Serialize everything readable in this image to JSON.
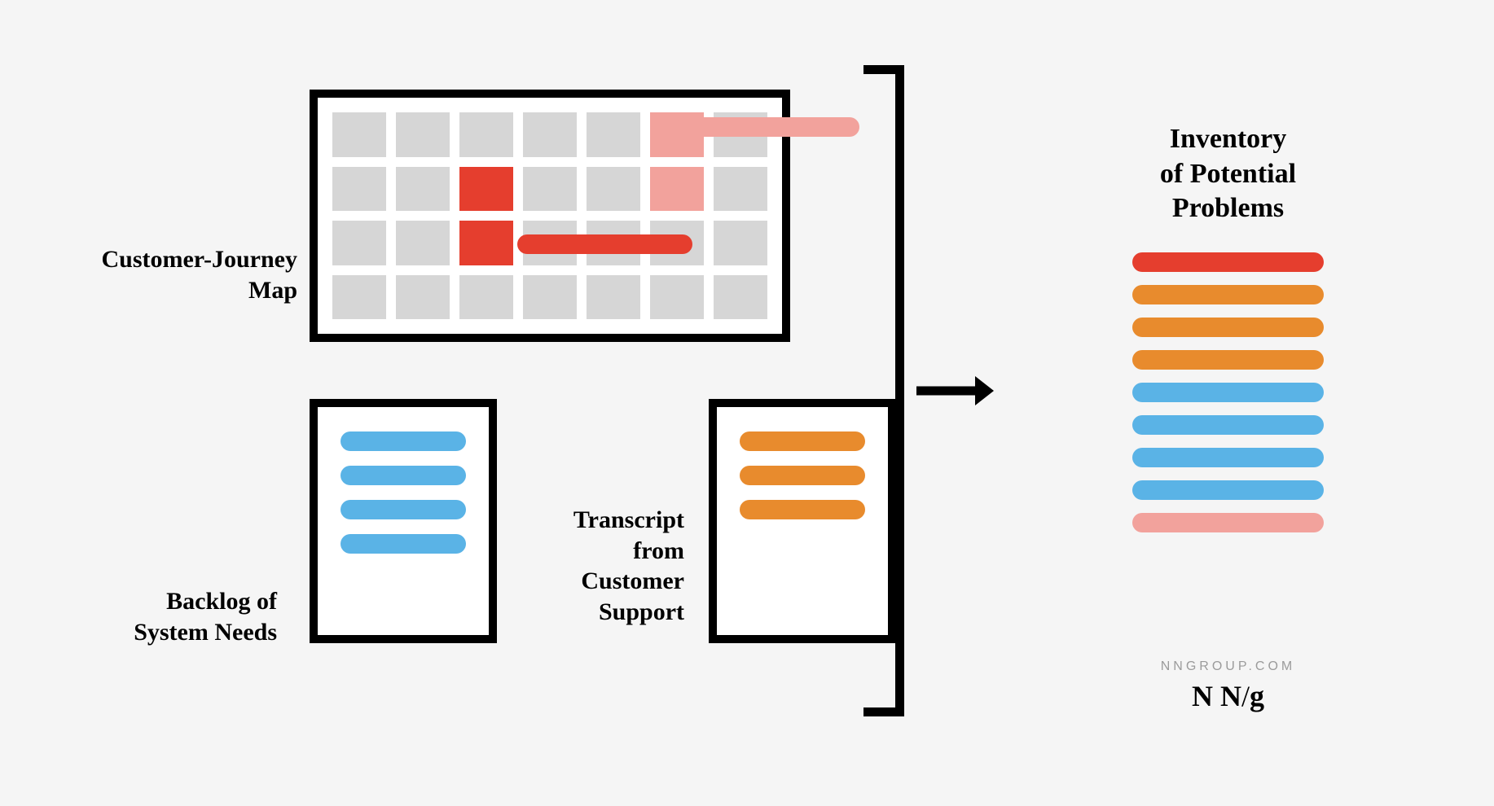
{
  "labels": {
    "journey_l1": "Customer-Journey",
    "journey_l2": "Map",
    "backlog_l1": "Backlog of",
    "backlog_l2": "System Needs",
    "transcript_l1": "Transcript",
    "transcript_l2": "from",
    "transcript_l3": "Customer",
    "transcript_l4": "Support",
    "inventory_l1": "Inventory",
    "inventory_l2": "of Potential",
    "inventory_l3": "Problems"
  },
  "journey_map": {
    "rows": 4,
    "cols": 7,
    "highlights": [
      {
        "row": 0,
        "col": 5,
        "style": "pink"
      },
      {
        "row": 1,
        "col": 2,
        "style": "red"
      },
      {
        "row": 1,
        "col": 5,
        "style": "pink"
      },
      {
        "row": 2,
        "col": 2,
        "style": "red"
      }
    ],
    "callouts": [
      {
        "color": "pink",
        "row": 0
      },
      {
        "color": "red",
        "row": 2
      }
    ]
  },
  "backlog": {
    "color": "blue",
    "count": 4
  },
  "transcript": {
    "color": "orange",
    "count": 3
  },
  "inventory": [
    "red",
    "orange",
    "orange",
    "orange",
    "blue",
    "blue",
    "blue",
    "blue",
    "pink"
  ],
  "footer": {
    "site": "NNGROUP.COM",
    "logo_a": "N N",
    "logo_b": "/",
    "logo_c": "g"
  },
  "colors": {
    "red": "#e53e2e",
    "pink": "#f2a29c",
    "orange": "#e88b2d",
    "blue": "#5ab3e6",
    "grey": "#d6d6d6"
  }
}
